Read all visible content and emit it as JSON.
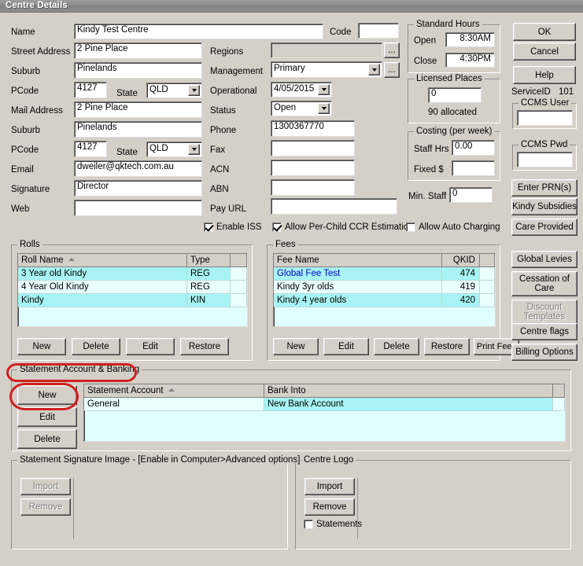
{
  "window": {
    "title": "Centre Details"
  },
  "form": {
    "name": {
      "label": "Name",
      "value": "Kindy Test Centre"
    },
    "code": {
      "label": "Code",
      "value": ""
    },
    "street_address": {
      "label": "Street Address",
      "value": "2 Pine Place"
    },
    "suburb1": {
      "label": "Suburb",
      "value": "Pinelands"
    },
    "pcode1": {
      "label": "PCode",
      "value": "4127"
    },
    "state1": {
      "label": "State",
      "value": "QLD"
    },
    "mail_address": {
      "label": "Mail Address",
      "value": "2 Pine Place"
    },
    "suburb2": {
      "label": "Suburb",
      "value": "Pinelands"
    },
    "pcode2": {
      "label": "PCode",
      "value": "4127"
    },
    "state2": {
      "label": "State",
      "value": "QLD"
    },
    "email": {
      "label": "Email",
      "value": "dweiler@qktech.com.au"
    },
    "signature": {
      "label": "Signature",
      "value": "Director"
    },
    "web": {
      "label": "Web",
      "value": ""
    },
    "regions": {
      "label": "Regions",
      "value": "",
      "browse": "..."
    },
    "management": {
      "label": "Management",
      "value": "Primary",
      "browse": "..."
    },
    "operational": {
      "label": "Operational",
      "value": "4/05/2015"
    },
    "status": {
      "label": "Status",
      "value": "Open"
    },
    "phone": {
      "label": "Phone",
      "value": "1300367770"
    },
    "fax": {
      "label": "Fax",
      "value": ""
    },
    "acn": {
      "label": "ACN",
      "value": ""
    },
    "abn": {
      "label": "ABN",
      "value": ""
    },
    "pay_url": {
      "label": "Pay URL",
      "value": ""
    }
  },
  "standard_hours": {
    "title": "Standard Hours",
    "open_label": "Open",
    "open_value": "8:30AM",
    "close_label": "Close",
    "close_value": "4:30PM"
  },
  "licensed_places": {
    "title": "Licensed Places",
    "value": "0",
    "allocated": "90 allocated"
  },
  "costing": {
    "title": "Costing (per week)",
    "staff_hrs_label": "Staff Hrs",
    "staff_hrs_value": "0.00",
    "fixed_label": "Fixed $",
    "fixed_value": ""
  },
  "min_staff": {
    "label": "Min. Staff",
    "value": "0"
  },
  "checkboxes": [
    {
      "label": "Enable ISS",
      "checked": true
    },
    {
      "label": "Allow Per-Child CCR Estimation",
      "checked": true
    },
    {
      "label": "Allow Auto Charging",
      "checked": false
    }
  ],
  "rolls": {
    "title": "Rolls",
    "columns": [
      "Roll Name",
      "Type"
    ],
    "sort_column": "Roll Name",
    "rows": [
      {
        "name": "3 Year old Kindy",
        "type": "REG"
      },
      {
        "name": "4 Year Old Kindy",
        "type": "REG"
      },
      {
        "name": "Kindy",
        "type": "KIN"
      }
    ],
    "buttons": [
      "New",
      "Delete",
      "Edit",
      "Restore"
    ]
  },
  "fees": {
    "title": "Fees",
    "columns": [
      "Fee Name",
      "QKID"
    ],
    "rows": [
      {
        "name": "Global Fee Test",
        "qkid": "474"
      },
      {
        "name": "Kindy 3yr olds",
        "qkid": "419"
      },
      {
        "name": "Kindy 4 year olds",
        "qkid": "420"
      }
    ],
    "buttons": [
      "New",
      "Edit",
      "Delete",
      "Restore",
      "Print Fees"
    ]
  },
  "statement_account": {
    "title": "Statement Account & Banking",
    "columns": [
      "Statement Account",
      "Bank Into"
    ],
    "sort_column": "Statement Account",
    "rows": [
      {
        "account": "General",
        "bank_into": "New Bank Account"
      }
    ],
    "buttons": [
      "New",
      "Edit",
      "Delete"
    ]
  },
  "signature_image": {
    "title": "Statement Signature Image - [Enable in Computer>Advanced options]",
    "import_label": "Import",
    "remove_label": "Remove"
  },
  "centre_logo": {
    "title": "Centre Logo",
    "import_label": "Import",
    "remove_label": "Remove",
    "statements_label": "Statements",
    "statements_checked": false
  },
  "right_panel": {
    "ok": "OK",
    "cancel": "Cancel",
    "help": "Help",
    "service_id_label": "ServiceID",
    "service_id_value": "101",
    "ccms_user_title": "CCMS User",
    "ccms_user_value": "",
    "ccms_pwd_title": "CCMS Pwd",
    "ccms_pwd_value": "",
    "enter_prns": "Enter PRN(s)",
    "kindy_subsidies": "Kindy Subsidies",
    "care_provided": "Care Provided",
    "global_levies": "Global Levies",
    "cessation_of_care": "Cessation of Care",
    "discount_templates": "Discount Templates",
    "centre_flags": "Centre flags",
    "billing_options": "Billing Options"
  },
  "colors": {
    "window_bg": "#d4d0c8",
    "grid_bg": "#e0ffff",
    "grid_row_highlight": "#a8f4f4",
    "annotation": "#d01f1f",
    "link_text": "#0000c8"
  }
}
